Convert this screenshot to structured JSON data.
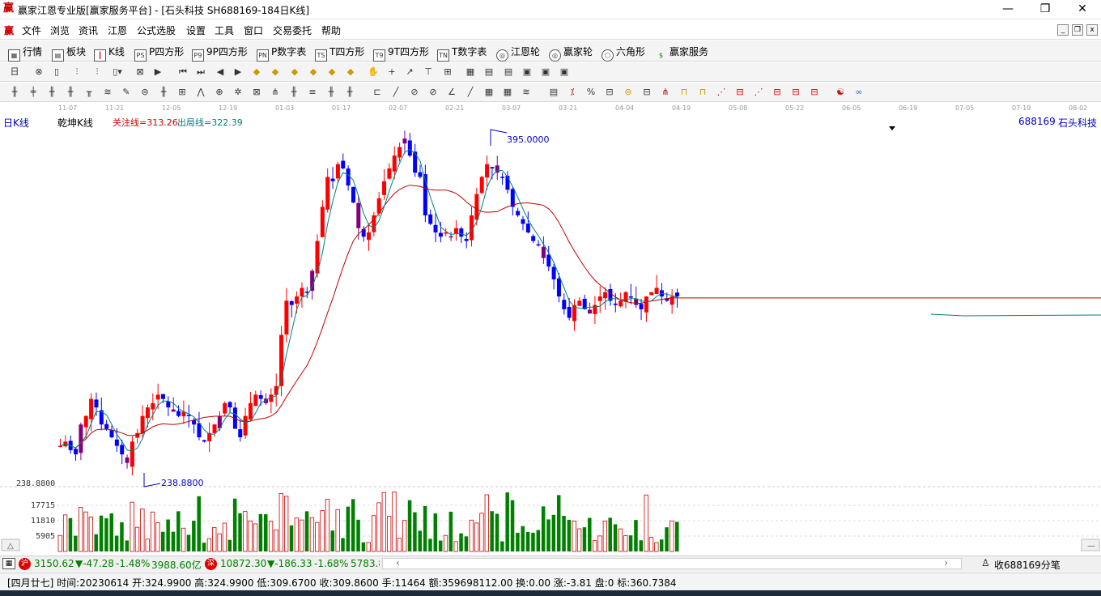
{
  "window": {
    "title": "赢家江恩专业版[赢家服务平台] - [石头科技  SH688169-184日K线]",
    "app_icon": "赢"
  },
  "menu": [
    "文件",
    "浏览",
    "资讯",
    "江恩",
    "公式选股",
    "设置",
    "工具",
    "窗口",
    "交易委托",
    "帮助"
  ],
  "menu_icon": "赢",
  "toolbar1": [
    {
      "icon": "grid-icon",
      "label": "行情"
    },
    {
      "icon": "blocks-icon",
      "label": "板块"
    },
    {
      "icon": "kline-icon",
      "label": "K线"
    },
    {
      "icon": "ps-icon",
      "label": "P四方形",
      "glyph": "PS"
    },
    {
      "icon": "p9-icon",
      "label": "9P四方形",
      "glyph": "P9"
    },
    {
      "icon": "pn-icon",
      "label": "P数字表",
      "glyph": "PN"
    },
    {
      "icon": "ts-icon",
      "label": "T四方形",
      "glyph": "TS"
    },
    {
      "icon": "t9-icon",
      "label": "9T四方形",
      "glyph": "T9"
    },
    {
      "icon": "tn-icon",
      "label": "T数字表",
      "glyph": "TN"
    },
    {
      "icon": "wheel-icon",
      "label": "江恩轮"
    },
    {
      "icon": "winner-wheel-icon",
      "label": "赢家轮"
    },
    {
      "icon": "hexagon-icon",
      "label": "六角形"
    },
    {
      "icon": "dollar-icon",
      "label": "赢家服务"
    }
  ],
  "chart_header": {
    "period_label": "日K线",
    "indicator_name": "乾坤K线",
    "focus_line": "关注线=313.26",
    "exit_line": "出局线=322.39",
    "stock_code": "688169",
    "stock_name": "石头科技",
    "high_marker": "395.0000",
    "low_marker": "238.8800",
    "price_axis_low": "238.8800"
  },
  "date_axis": [
    "11-07",
    "11-21",
    "12-05",
    "12-19",
    "01-03",
    "01-17",
    "02-07",
    "02-21",
    "03-07",
    "03-21",
    "04-04",
    "04-19",
    "05-08",
    "05-22",
    "06-05",
    "06-19",
    "07-05",
    "07-19",
    "08-02"
  ],
  "volume_axis": [
    "17715",
    "11810",
    "5905"
  ],
  "status_indices": [
    {
      "icon": "sh-icon",
      "glyph": "沪",
      "value": "3150.62",
      "change": "▼-47.28",
      "pct": "-1.48%",
      "amount": "3988.60亿"
    },
    {
      "icon": "sz-icon",
      "glyph": "深",
      "value": "10872.30",
      "change": "▼-186.33",
      "pct": "-1.68%",
      "amount": "5783.8"
    }
  ],
  "status_right": "收688169分笔",
  "bottom_info": "[四月廿七] 时间:20230614 开:324.9900 高:324.9900 低:309.6700 收:309.8600 手:11464 额:359698112.00 换:0.00 涨:-3.81 盘:0 标:360.7384",
  "colors": {
    "up": "#ff0000",
    "down": "#0000ff",
    "neutral": "#800080",
    "ma": "#c00000",
    "fast": "#008080",
    "vol_up": "#d00000",
    "vol_down": "#008000"
  },
  "chart_data": {
    "type": "candlestick",
    "ylim": [
      230,
      400
    ],
    "closes": [
      248,
      250,
      246,
      244,
      258,
      262,
      270,
      266,
      258,
      256,
      252,
      248,
      244,
      240,
      250,
      254,
      262,
      266,
      268,
      272,
      270,
      266,
      264,
      262,
      264,
      262,
      258,
      252,
      250,
      254,
      258,
      262,
      268,
      266,
      256,
      252,
      262,
      268,
      272,
      270,
      268,
      272,
      276,
      300,
      316,
      314,
      318,
      322,
      320,
      330,
      344,
      360,
      374,
      372,
      380,
      378,
      370,
      362,
      350,
      346,
      348,
      356,
      364,
      372,
      378,
      384,
      388,
      392,
      384,
      376,
      374,
      356,
      352,
      348,
      346,
      348,
      346,
      350,
      346,
      344,
      356,
      366,
      374,
      380,
      378,
      376,
      374,
      368,
      360,
      356,
      352,
      348,
      344,
      342,
      336,
      332,
      326,
      318,
      312,
      308,
      314,
      316,
      312,
      310,
      314,
      318,
      320,
      316,
      314,
      316,
      320,
      318,
      314,
      312,
      318,
      320,
      322,
      318,
      316,
      318,
      318
    ]
  }
}
